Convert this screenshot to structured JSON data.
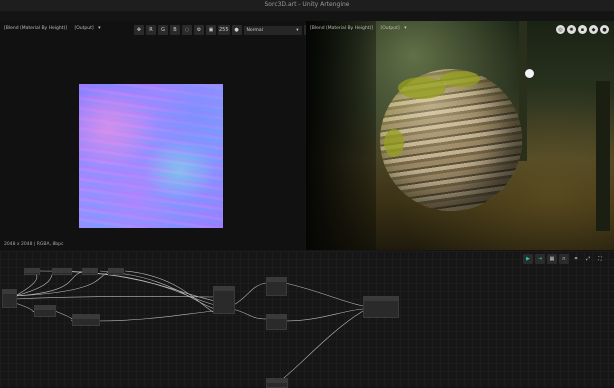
{
  "window": {
    "title": "Sorc3D.art - Unity Artengine"
  },
  "viewport_2d": {
    "source": "[Blend (Material By Height)]",
    "output": "[Output]",
    "toolbar": {
      "channels": [
        "R",
        "G",
        "B"
      ],
      "zoom": "255",
      "mode": "Normal"
    },
    "status": "2048 x 2048 | RGBA, 8bpc"
  },
  "viewport_3d": {
    "source": "[Blend (Material By Height)]",
    "output": "[Output]"
  },
  "colors": {
    "accent": "#18d1b0",
    "panel": "#111111",
    "graph_bg": "#161616"
  }
}
